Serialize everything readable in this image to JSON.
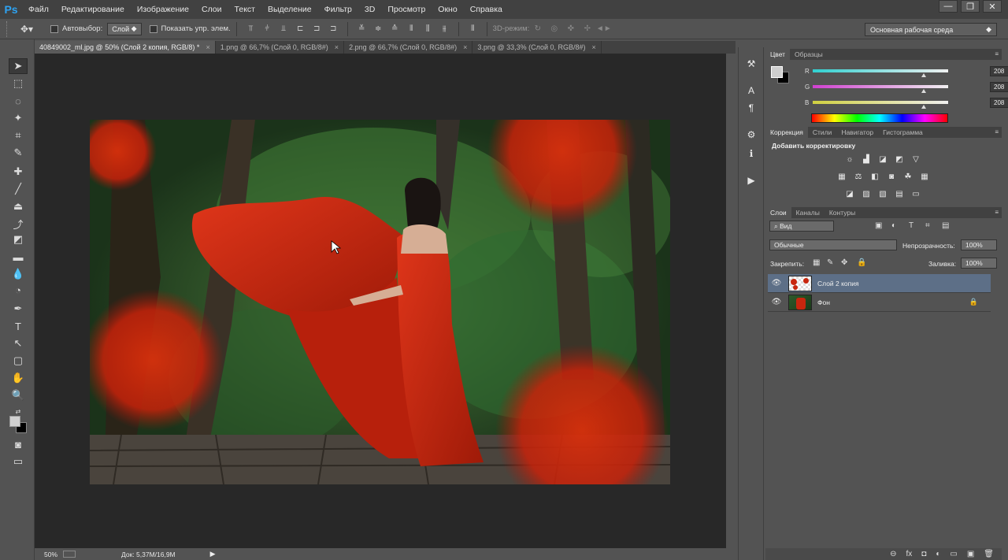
{
  "app": {
    "logo": "Ps"
  },
  "menu": [
    "Файл",
    "Редактирование",
    "Изображение",
    "Слои",
    "Текст",
    "Выделение",
    "Фильтр",
    "3D",
    "Просмотр",
    "Окно",
    "Справка"
  ],
  "window_controls": {
    "minimize": "—",
    "restore": "❐",
    "close": "✕"
  },
  "options": {
    "autoselect_label": "Автовыбор:",
    "autoselect_value": "Слой",
    "show_controls_label": "Показать упр. элем.",
    "mode3d_label": "3D-режим:",
    "workspace": "Основная рабочая среда"
  },
  "tabs": [
    {
      "label": "40849002_ml.jpg @ 50% (Слой 2 копия, RGB/8) *",
      "close": "×"
    },
    {
      "label": "1.png @ 66,7% (Слой 0, RGB/8#)",
      "close": "×"
    },
    {
      "label": "2.png @ 66,7% (Слой 0, RGB/8#)",
      "close": "×"
    },
    {
      "label": "3.png @ 33,3% (Слой 0, RGB/8#)",
      "close": "×"
    }
  ],
  "status": {
    "zoom": "50%",
    "doc": "Док: 5,37M/16,9M",
    "arrow": "▶"
  },
  "color_panel": {
    "tabs": [
      "Цвет",
      "Образцы"
    ],
    "channels": [
      {
        "name": "R",
        "value": "208",
        "color": "#00d0d0"
      },
      {
        "name": "G",
        "value": "208",
        "color": "#d040d0"
      },
      {
        "name": "B",
        "value": "208",
        "color": "#d0d040"
      }
    ],
    "fg_color": "#d0d0d0",
    "bg_color": "#000000"
  },
  "adjust_panel": {
    "tabs": [
      "Коррекция",
      "Стили",
      "Навигатор",
      "Гистограмма"
    ],
    "title": "Добавить корректировку"
  },
  "layers_panel": {
    "tabs": [
      "Слои",
      "Каналы",
      "Контуры"
    ],
    "filter": "Вид",
    "blend": "Обычные",
    "opacity_label": "Непрозрачность:",
    "opacity": "100%",
    "lock_label": "Закрепить:",
    "fill_label": "Заливка:",
    "fill": "100%",
    "layers": [
      {
        "name": "Слой 2 копия",
        "selected": true,
        "visible": "👁"
      },
      {
        "name": "Фон",
        "selected": false,
        "visible": "👁",
        "lock": "🔒"
      }
    ],
    "footer": [
      "⊖",
      "fx",
      "◘",
      "◐",
      "▭",
      "▣",
      "🗑"
    ]
  },
  "colors": {
    "accent": "#2ea3f2",
    "selected_layer": "#5d6f87",
    "canvas_bg": "#282828",
    "dress_red": "#c8260e"
  }
}
